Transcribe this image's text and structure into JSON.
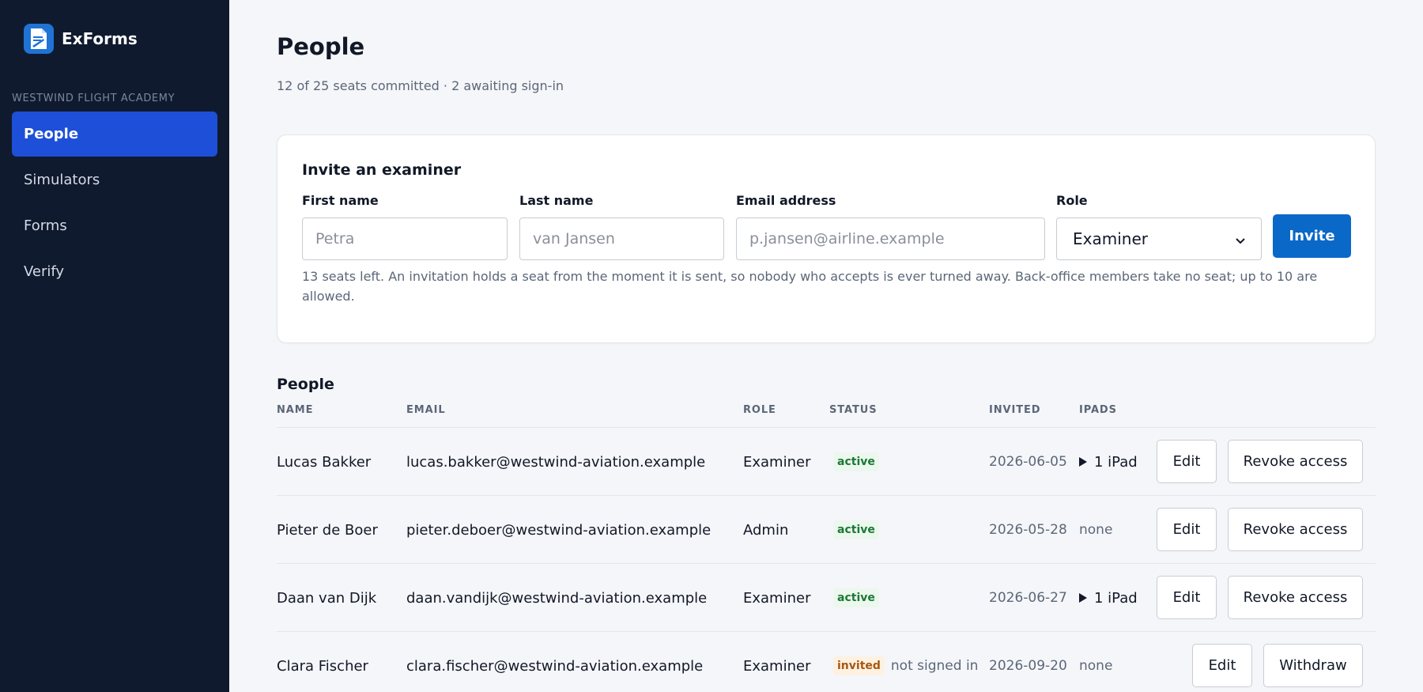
{
  "app": {
    "name": "ExForms",
    "icon": "form-document-icon"
  },
  "sidebar": {
    "org_label": "WESTWIND FLIGHT ACADEMY",
    "items": [
      {
        "label": "People",
        "active": true
      },
      {
        "label": "Simulators",
        "active": false
      },
      {
        "label": "Forms",
        "active": false
      },
      {
        "label": "Verify",
        "active": false
      }
    ]
  },
  "page": {
    "title": "People",
    "subtitle": "12 of 25 seats committed · 2 awaiting sign-in"
  },
  "invite": {
    "title": "Invite an examiner",
    "first_name": {
      "label": "First name",
      "placeholder": "Petra",
      "value": ""
    },
    "last_name": {
      "label": "Last name",
      "placeholder": "van Jansen",
      "value": ""
    },
    "email": {
      "label": "Email address",
      "placeholder": "p.jansen@airline.example",
      "value": ""
    },
    "role": {
      "label": "Role",
      "value": "Examiner"
    },
    "button": "Invite",
    "note": "13 seats left. An invitation holds a seat from the moment it is sent, so nobody who accepts is ever turned away. Back-office members take no seat; up to 10 are allowed."
  },
  "people": {
    "title": "People",
    "columns": [
      "NAME",
      "EMAIL",
      "ROLE",
      "STATUS",
      "INVITED",
      "IPADS"
    ],
    "rows": [
      {
        "name": "Lucas Bakker",
        "email": "lucas.bakker@westwind-aviation.example",
        "role": "Examiner",
        "status": "active",
        "status_note": "",
        "invited": "2026-06-05",
        "ipads": "1 iPad",
        "ipads_expandable": true,
        "actions": [
          "Edit",
          "Revoke access"
        ]
      },
      {
        "name": "Pieter de Boer",
        "email": "pieter.deboer@westwind-aviation.example",
        "role": "Admin",
        "status": "active",
        "status_note": "",
        "invited": "2026-05-28",
        "ipads": "none",
        "ipads_expandable": false,
        "actions": [
          "Edit",
          "Revoke access"
        ]
      },
      {
        "name": "Daan van Dijk",
        "email": "daan.vandijk@westwind-aviation.example",
        "role": "Examiner",
        "status": "active",
        "status_note": "",
        "invited": "2026-06-27",
        "ipads": "1 iPad",
        "ipads_expandable": true,
        "actions": [
          "Edit",
          "Revoke access"
        ]
      },
      {
        "name": "Clara Fischer",
        "email": "clara.fischer@westwind-aviation.example",
        "role": "Examiner",
        "status": "invited",
        "status_note": "not signed in",
        "invited": "2026-09-20",
        "ipads": "none",
        "ipads_expandable": false,
        "actions": [
          "Edit",
          "Withdraw"
        ]
      }
    ]
  },
  "colors": {
    "sidebar_bg": "#101a2e",
    "nav_active": "#1d4fd8",
    "primary_button": "#0a68c8",
    "active_badge": "#1a7a35",
    "invited_badge": "#a85710"
  }
}
